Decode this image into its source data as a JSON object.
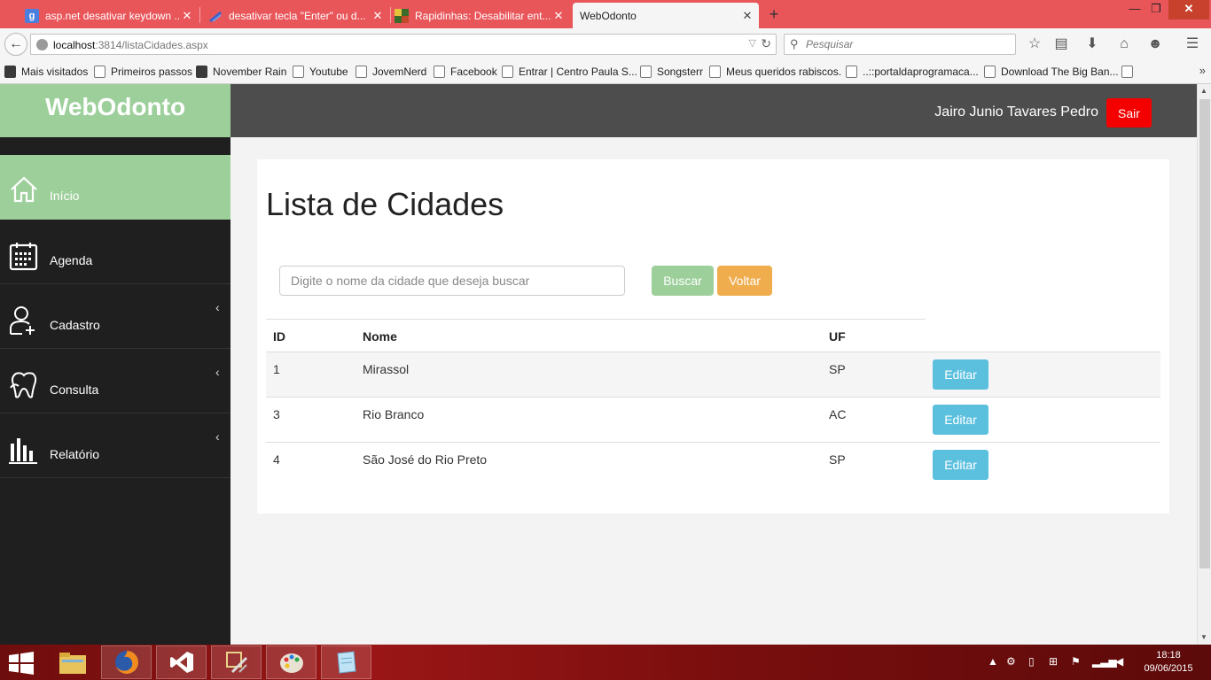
{
  "browser": {
    "tabs": [
      {
        "title": "asp.net desativar keydown ...",
        "icon": "google-icon",
        "active": false
      },
      {
        "title": "desativar tecla \"Enter\" ou d...",
        "icon": "stackoverflow-icon",
        "active": false
      },
      {
        "title": "Rapidinhas: Desabilitar ent...",
        "icon": "site-icon",
        "active": false
      },
      {
        "title": "WebOdonto",
        "icon": "page-icon",
        "active": true
      }
    ],
    "url": {
      "host": "localhost",
      "rest": ":3814/listaCidades.aspx"
    },
    "search_placeholder": "Pesquisar",
    "bookmarks": [
      "Mais visitados",
      "Primeiros passos",
      "November Rain",
      "Youtube",
      "JovemNerd",
      "Facebook",
      "Entrar | Centro Paula S...",
      "Songsterr",
      "Meus queridos rabiscos.",
      "..::portaldaprogramaca...",
      "Download The Big Ban..."
    ]
  },
  "app": {
    "brand": "WebOdonto",
    "user_name": "Jairo Junio Tavares Pedro",
    "logout_label": "Sair",
    "sidebar": [
      {
        "label": "Início",
        "icon": "home-icon",
        "active": true
      },
      {
        "label": "Agenda",
        "icon": "calendar-icon",
        "active": false
      },
      {
        "label": "Cadastro",
        "icon": "user-add-icon",
        "active": false,
        "submenu": true
      },
      {
        "label": "Consulta",
        "icon": "tooth-icon",
        "active": false,
        "submenu": true
      },
      {
        "label": "Relatório",
        "icon": "bar-chart-icon",
        "active": false,
        "submenu": true
      }
    ],
    "page_title": "Lista de Cidades",
    "search": {
      "placeholder": "Digite o nome da cidade que deseja buscar",
      "value": ""
    },
    "buttons": {
      "search": "Buscar",
      "back": "Voltar"
    },
    "table": {
      "headers": {
        "id": "ID",
        "nome": "Nome",
        "uf": "UF"
      },
      "edit_label": "Editar",
      "rows": [
        {
          "id": "1",
          "nome": "Mirassol",
          "uf": "SP"
        },
        {
          "id": "3",
          "nome": "Rio Branco",
          "uf": "AC"
        },
        {
          "id": "4",
          "nome": "São José do Rio Preto",
          "uf": "SP"
        }
      ]
    },
    "colors": {
      "brand_green": "#9dcf9b",
      "sidebar_bg": "#1f1f1f",
      "topbar_bg": "#4d4d4d",
      "logout_red": "#f40000",
      "edit_blue": "#5bc0de",
      "back_orange": "#f0ad4e"
    }
  },
  "taskbar": {
    "apps": [
      "file-explorer-icon",
      "firefox-icon",
      "visual-studio-icon",
      "tools-icon",
      "paint-icon",
      "notepad-icon"
    ],
    "clock": {
      "time": "18:18",
      "date": "09/06/2015"
    }
  }
}
